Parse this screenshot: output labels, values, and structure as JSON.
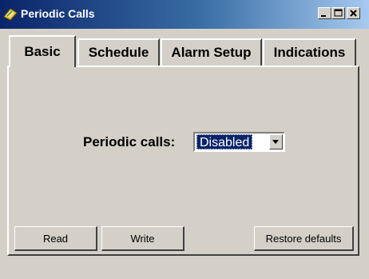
{
  "window": {
    "title": "Periodic Calls",
    "controls": [
      "minimize-icon",
      "maximize-icon",
      "close-icon"
    ]
  },
  "tabs": [
    {
      "label": "Basic",
      "active": true
    },
    {
      "label": "Schedule",
      "active": false
    },
    {
      "label": "Alarm Setup",
      "active": false
    },
    {
      "label": "Indications",
      "active": false
    }
  ],
  "form": {
    "periodic_label": "Periodic calls:",
    "periodic_value": "Disabled"
  },
  "buttons": {
    "read": "Read",
    "write": "Write",
    "restore": "Restore defaults"
  },
  "colors": {
    "face": "#d4d0c8",
    "title_start": "#0a246a",
    "title_end": "#a6caf0",
    "selection": "#0a246a"
  }
}
